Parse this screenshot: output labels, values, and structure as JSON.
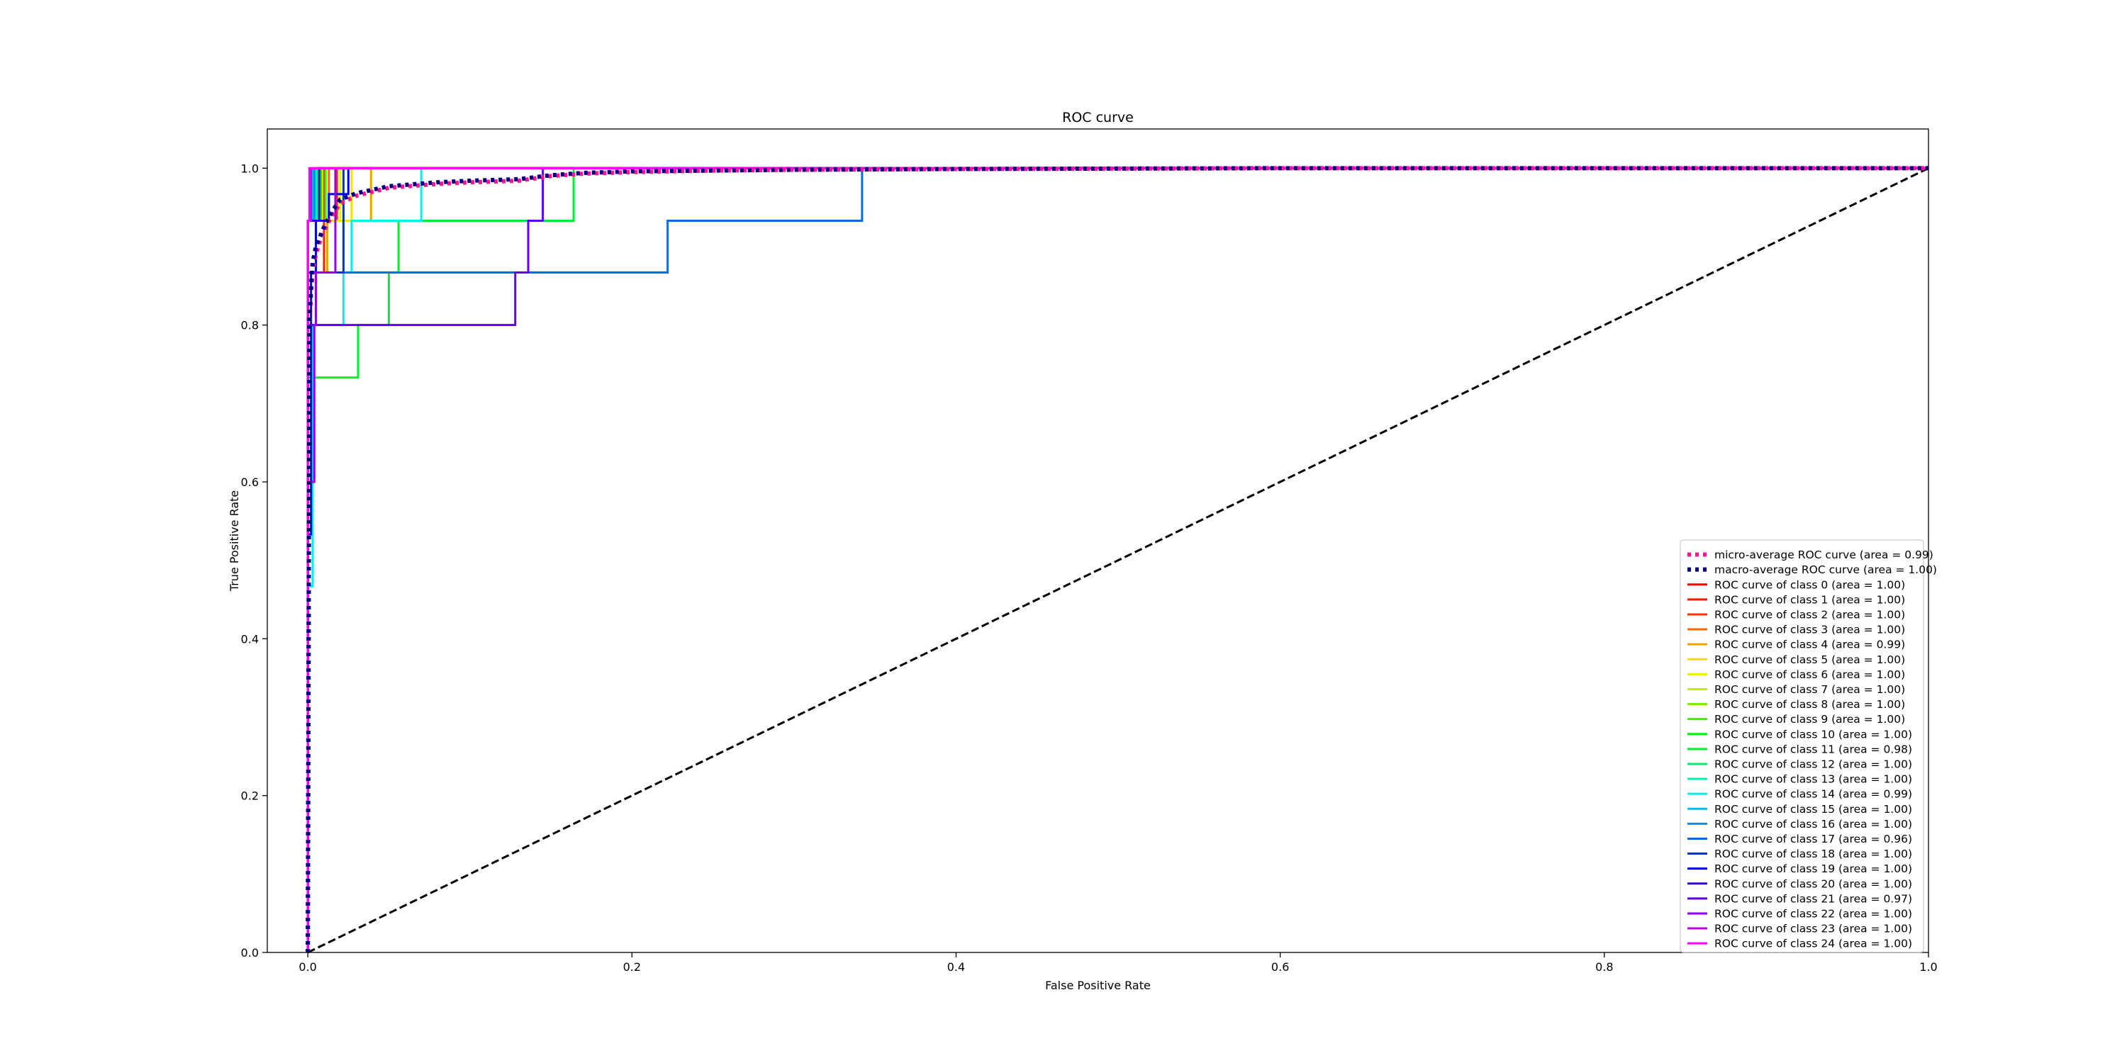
{
  "chart_data": {
    "type": "line",
    "title": "ROC curve",
    "xlabel": "False Positive Rate",
    "ylabel": "True Positive Rate",
    "xlim": [
      -0.025,
      1.0
    ],
    "ylim": [
      0.0,
      1.05
    ],
    "xticks": [
      0.0,
      0.2,
      0.4,
      0.6,
      0.8,
      1.0
    ],
    "yticks": [
      0.0,
      0.2,
      0.4,
      0.6,
      0.8,
      1.0
    ],
    "xtick_labels": [
      "0.0",
      "0.2",
      "0.4",
      "0.6",
      "0.8",
      "1.0"
    ],
    "ytick_labels": [
      "0.0",
      "0.2",
      "0.4",
      "0.6",
      "0.8",
      "1.0"
    ],
    "grid": false,
    "legend_position": "lower-right",
    "series": [
      {
        "name": "micro-average ROC curve (area = 0.99)",
        "color": "#ff1493",
        "style": "dotted",
        "x": [
          0,
          0.001,
          0.002,
          0.003,
          0.005,
          0.008,
          0.01,
          0.015,
          0.02,
          0.03,
          0.05,
          0.08,
          0.1,
          0.13,
          0.15,
          0.17,
          0.2,
          0.25,
          0.3,
          0.4,
          0.6,
          0.8,
          1.0
        ],
        "y": [
          0,
          0.8,
          0.84,
          0.87,
          0.89,
          0.91,
          0.92,
          0.94,
          0.955,
          0.965,
          0.975,
          0.98,
          0.982,
          0.984,
          0.99,
          0.993,
          0.995,
          0.997,
          0.998,
          0.999,
          1.0,
          1.0,
          1.0
        ]
      },
      {
        "name": "macro-average ROC curve (area = 1.00)",
        "color": "#000080",
        "style": "dotted",
        "x": [
          0,
          0.001,
          0.002,
          0.003,
          0.005,
          0.008,
          0.01,
          0.015,
          0.02,
          0.03,
          0.05,
          0.08,
          0.1,
          0.13,
          0.15,
          0.17,
          0.2,
          0.25,
          0.3,
          0.4,
          0.6,
          0.8,
          1.0
        ],
        "y": [
          0,
          0.81,
          0.85,
          0.88,
          0.9,
          0.915,
          0.925,
          0.945,
          0.96,
          0.968,
          0.977,
          0.982,
          0.984,
          0.986,
          0.991,
          0.994,
          0.996,
          0.997,
          0.998,
          0.999,
          1.0,
          1.0,
          1.0
        ]
      },
      {
        "name": "ROC curve of class 0 (area = 1.00)",
        "color": "#ff0000",
        "x": [
          0,
          0,
          0.004,
          0.004,
          1
        ],
        "y": [
          0,
          0.933,
          0.933,
          1,
          1
        ]
      },
      {
        "name": "ROC curve of class 1 (area = 1.00)",
        "color": "#ff1a00",
        "x": [
          0,
          0,
          0.01,
          0.01,
          1
        ],
        "y": [
          0,
          0.867,
          0.867,
          1,
          1
        ]
      },
      {
        "name": "ROC curve of class 2 (area = 1.00)",
        "color": "#ff3300",
        "x": [
          0,
          0,
          0.018,
          0.018,
          1
        ],
        "y": [
          0,
          0.933,
          0.933,
          1,
          1
        ]
      },
      {
        "name": "ROC curve of class 3 (area = 1.00)",
        "color": "#ff6600",
        "x": [
          0,
          0,
          0.013,
          0.013,
          1
        ],
        "y": [
          0,
          0.933,
          0.933,
          1,
          1
        ]
      },
      {
        "name": "ROC curve of class 4 (area = 0.99)",
        "color": "#f0a000",
        "x": [
          0,
          0,
          0.012,
          0.012,
          0.039,
          0.039,
          1
        ],
        "y": [
          0,
          0.867,
          0.867,
          0.933,
          0.933,
          1,
          1
        ]
      },
      {
        "name": "ROC curve of class 5 (area = 1.00)",
        "color": "#f5e000",
        "x": [
          0,
          0,
          0.027,
          0.027,
          1
        ],
        "y": [
          0,
          0.933,
          0.933,
          1,
          1
        ]
      },
      {
        "name": "ROC curve of class 6 (area = 1.00)",
        "color": "#e6f000",
        "x": [
          0,
          0,
          0.02,
          0.02,
          1
        ],
        "y": [
          0,
          0.933,
          0.933,
          1,
          1
        ]
      },
      {
        "name": "ROC curve of class 7 (area = 1.00)",
        "color": "#c0f000",
        "x": [
          0,
          0,
          0.009,
          0.009,
          1
        ],
        "y": [
          0,
          0.933,
          0.933,
          1,
          1
        ]
      },
      {
        "name": "ROC curve of class 8 (area = 1.00)",
        "color": "#80f000",
        "x": [
          0,
          0,
          0.007,
          0.007,
          1
        ],
        "y": [
          0,
          0.933,
          0.933,
          1,
          1
        ]
      },
      {
        "name": "ROC curve of class 9 (area = 1.00)",
        "color": "#40f000",
        "x": [
          0,
          0,
          0.011,
          0.011,
          1
        ],
        "y": [
          0,
          0.933,
          0.933,
          1,
          1
        ]
      },
      {
        "name": "ROC curve of class 10 (area = 1.00)",
        "color": "#00f000",
        "x": [
          0,
          0,
          0.008,
          0.008,
          1
        ],
        "y": [
          0,
          0.933,
          0.933,
          1,
          1
        ]
      },
      {
        "name": "ROC curve of class 11 (area = 0.98)",
        "color": "#00f030",
        "x": [
          0,
          0,
          0.031,
          0.031,
          0.05,
          0.05,
          0.056,
          0.056,
          0.164,
          0.164,
          1
        ],
        "y": [
          0,
          0.733,
          0.733,
          0.8,
          0.8,
          0.867,
          0.867,
          0.933,
          0.933,
          1,
          1
        ]
      },
      {
        "name": "ROC curve of class 12 (area = 1.00)",
        "color": "#00f070",
        "x": [
          0,
          0,
          0.006,
          0.006,
          1
        ],
        "y": [
          0,
          0.933,
          0.933,
          1,
          1
        ]
      },
      {
        "name": "ROC curve of class 13 (area = 1.00)",
        "color": "#00f0b0",
        "x": [
          0,
          0,
          0.005,
          0.005,
          1
        ],
        "y": [
          0,
          0.933,
          0.933,
          1,
          1
        ]
      },
      {
        "name": "ROC curve of class 14 (area = 0.99)",
        "color": "#00f0f0",
        "x": [
          0,
          0,
          0.003,
          0.003,
          0.022,
          0.022,
          0.027,
          0.027,
          0.07,
          0.07,
          1
        ],
        "y": [
          0,
          0.467,
          0.467,
          0.8,
          0.8,
          0.867,
          0.867,
          0.933,
          0.933,
          1,
          1
        ]
      },
      {
        "name": "ROC curve of class 15 (area = 1.00)",
        "color": "#00c0f0",
        "x": [
          0,
          0,
          0.003,
          0.003,
          1
        ],
        "y": [
          0,
          0.933,
          0.933,
          1,
          1
        ]
      },
      {
        "name": "ROC curve of class 16 (area = 1.00)",
        "color": "#0090f0",
        "x": [
          0,
          0,
          0.004,
          0.004,
          1
        ],
        "y": [
          0,
          0.933,
          0.933,
          1,
          1
        ]
      },
      {
        "name": "ROC curve of class 17 (area = 0.96)",
        "color": "#0070e0",
        "x": [
          0,
          0,
          0.005,
          0.005,
          0.222,
          0.222,
          0.342,
          0.342,
          1
        ],
        "y": [
          0,
          0.8,
          0.8,
          0.867,
          0.867,
          0.933,
          0.933,
          1,
          1
        ]
      },
      {
        "name": "ROC curve of class 18 (area = 1.00)",
        "color": "#0030f0",
        "x": [
          0,
          0,
          0.022,
          0.022,
          1
        ],
        "y": [
          0,
          0.867,
          0.867,
          1,
          1
        ]
      },
      {
        "name": "ROC curve of class 19 (area = 1.00)",
        "color": "#0000f0",
        "x": [
          0,
          0,
          0.002,
          0.002,
          0.005,
          0.005,
          0.013,
          0.013,
          0.025,
          0.025,
          1
        ],
        "y": [
          0,
          0.533,
          0.533,
          0.867,
          0.867,
          0.933,
          0.933,
          0.967,
          0.967,
          1,
          1
        ]
      },
      {
        "name": "ROC curve of class 20 (area = 1.00)",
        "color": "#3000f0",
        "x": [
          0,
          0,
          0.007,
          0.007,
          1
        ],
        "y": [
          0,
          0.933,
          0.933,
          1,
          1
        ]
      },
      {
        "name": "ROC curve of class 21 (area = 0.97)",
        "color": "#6000f0",
        "x": [
          0,
          0,
          0.128,
          0.128,
          0.136,
          0.136,
          0.145,
          0.145,
          1
        ],
        "y": [
          0,
          0.8,
          0.8,
          0.867,
          0.867,
          0.933,
          0.933,
          1,
          1
        ]
      },
      {
        "name": "ROC curve of class 22 (area = 1.00)",
        "color": "#9000f0",
        "x": [
          0,
          0,
          0.004,
          0.004,
          0.005,
          0.005,
          0.017,
          0.017,
          1
        ],
        "y": [
          0,
          0.6,
          0.6,
          0.8,
          0.8,
          0.867,
          0.867,
          1,
          1
        ]
      },
      {
        "name": "ROC curve of class 23 (area = 1.00)",
        "color": "#c000f0",
        "x": [
          0,
          0,
          0.002,
          0.002,
          1
        ],
        "y": [
          0,
          0.933,
          0.933,
          1,
          1
        ]
      },
      {
        "name": "ROC curve of class 24 (area = 1.00)",
        "color": "#ff00ff",
        "x": [
          0,
          0,
          0.001,
          0.001,
          1
        ],
        "y": [
          0,
          0.933,
          0.933,
          1,
          1
        ]
      }
    ],
    "reference_line": {
      "x": [
        0,
        1
      ],
      "y": [
        0,
        1
      ],
      "color": "#000000",
      "style": "dashed"
    }
  }
}
